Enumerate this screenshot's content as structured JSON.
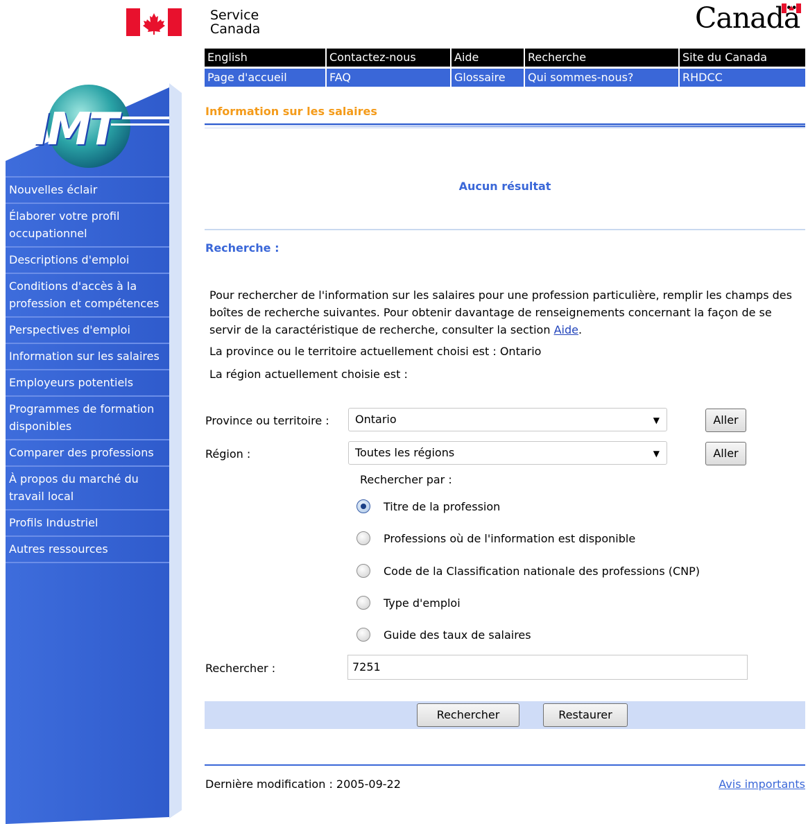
{
  "header": {
    "service_canada_line1": "Service",
    "service_canada_line2": "Canada",
    "wordmark": "Canadä",
    "nav_top": [
      "English",
      "Contactez-nous",
      "Aide",
      "Recherche",
      "Site du Canada"
    ],
    "nav_bottom": [
      "Page d'accueil",
      "FAQ",
      "Glossaire",
      "Qui sommes-nous?",
      "RHDCC"
    ]
  },
  "sidebar": {
    "logo": "IMT",
    "items": [
      "Nouvelles éclair",
      "Élaborer votre profil occupationnel",
      "Descriptions d'emploi",
      "Conditions d'accès à la profession et compétences",
      "Perspectives d'emploi",
      "Information sur les salaires",
      "Employeurs potentiels",
      "Programmes de formation disponibles",
      "Comparer des professions",
      "À propos du marché du travail local",
      "Profils Industriel",
      "Autres ressources"
    ]
  },
  "main": {
    "section_title": "Information sur les salaires",
    "no_result": "Aucun résultat",
    "search_title": "Recherche :",
    "intro_text": "Pour rechercher de l'information sur les salaires pour une profession particulière, remplir les champs des boîtes de recherche suivantes. Pour obtenir davantage de renseignements concernant la façon de se servir de la caractéristique de recherche, consulter la section ",
    "intro_link": "Aide",
    "intro_end": ".",
    "province_line": "La province ou le territoire actuellement choisi est : Ontario",
    "region_line": "La région actuellement choisie est :",
    "province_label": "Province ou territoire :",
    "province_value": "Ontario",
    "region_label": "Région :",
    "region_value": "Toutes les régions",
    "go_label": "Aller",
    "search_by_label": "Rechercher par :",
    "search_by_options": [
      "Titre de la profession",
      "Professions où de l'information est disponible",
      "Code de la Classification nationale des professions (CNP)",
      "Type d'emploi",
      "Guide des taux de salaires"
    ],
    "selected_option_index": 0,
    "search_label": "Rechercher :",
    "search_value": "7251",
    "search_button": "Rechercher",
    "reset_button": "Restaurer",
    "last_modified": "Dernière modification : 2005-09-22",
    "notices_link": "Avis importants"
  },
  "colors": {
    "brand_blue": "#3a67d8",
    "flag_red": "#e8112d",
    "section_orange": "#f49b1a"
  }
}
